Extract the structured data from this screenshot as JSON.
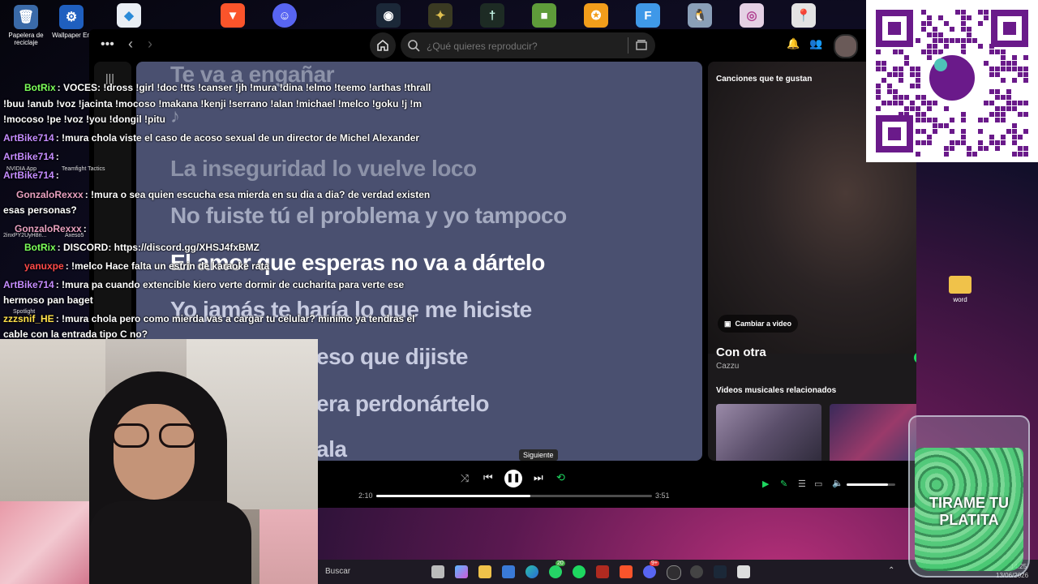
{
  "desktop": {
    "icons_left": [
      {
        "label": "Papelera de reciclaje",
        "icon": "recycle-bin-icon"
      },
      {
        "label": "Wallpaper En",
        "icon": "wallpaper-engine-icon"
      }
    ],
    "top_icons": [
      "kleopatra-icon",
      "brave-icon",
      "discord-icon",
      "steam-icon",
      "game-icon",
      "game2-icon",
      "minecraft-icon",
      "cs-icon",
      "f-icon",
      "penguin-icon",
      "circle-icon",
      "maps-icon"
    ],
    "right_icon": {
      "label": "word",
      "icon": "folder-icon"
    },
    "overlay_labels": {
      "nvidia": "NVIDIA App",
      "teamfight": "Teamfight Tactics",
      "zip": "2inxPY2UyH8ri...",
      "axeso": "Axeso5",
      "spotlight": "Spotlight"
    }
  },
  "spotify": {
    "search_placeholder": "¿Qué quieres reproducir?",
    "lyrics": [
      "Te va a engañar",
      "♪",
      "La inseguridad lo vuelve loco",
      "No fuiste tú el problema y yo tampoco",
      "El amor que esperas no va a dártelo",
      "Yo jamás te haría lo que me hiciste",
      "eso que dijiste",
      "era perdonártelo",
      "ala"
    ],
    "now_playing": {
      "section_title": "Canciones que te gustan",
      "switch_video": "Cambiar a video",
      "song": "Con otra",
      "artist": "Cazzu",
      "related_title": "Videos musicales relacionados"
    },
    "player": {
      "tooltip": "Siguiente",
      "elapsed": "2:10",
      "duration": "3:51",
      "progress": 0.56,
      "volume": 0.85
    }
  },
  "chat": [
    {
      "user": "BotRix",
      "color": "#7cff5a",
      "text": ": VOCES: !dross !girl !doc !tts !canser !jh !mura !dina !elmo !teemo !arthas !thrall"
    },
    {
      "user": "",
      "color": "#ffffff",
      "text": "!buu !anub !voz !jacinta !mocoso !makana !kenji !serrano !alan !michael !melco !goku !j !m"
    },
    {
      "user": "",
      "color": "#ffffff",
      "text": "!mocoso !pe !voz !you !dongil !pitu"
    },
    {
      "user": "ArtBike714",
      "color": "#c58cff",
      "text": ": !mura chola viste el caso de acoso sexual de un director de Michel Alexander"
    },
    {
      "user": "ArtBike714",
      "color": "#c58cff",
      "text": ":"
    },
    {
      "user": "ArtBike714",
      "color": "#c58cff",
      "text": ":"
    },
    {
      "user": "GonzaloRexxx",
      "color": "#e8a0c0",
      "text": ": !mura o sea quien escucha esa mierda en su dia a dia? de verdad existen"
    },
    {
      "user": "",
      "color": "#ffffff",
      "text": "esas personas?"
    },
    {
      "user": "GonzaloRexxx",
      "color": "#e8a0c0",
      "text": ":"
    },
    {
      "user": "BotRix",
      "color": "#7cff5a",
      "text": ": DISCORD: https://discord.gg/XHSJ4fxBMZ"
    },
    {
      "user": "yanuxpe",
      "color": "#ff4a4a",
      "text": ": !melco Hace falta un estrin de karaoke rata"
    },
    {
      "user": "ArtBike714",
      "color": "#c58cff",
      "text": ": !mura pa cuando extencible kiero verte dormir de cucharita para verte ese"
    },
    {
      "user": "",
      "color": "#ffffff",
      "text": "hermoso pan baget"
    },
    {
      "user": "zzzsnif_HE",
      "color": "#ffe14a",
      "text": ": !mura chola pero como mierda vas a cargar tu celular? minimo ya tendras el"
    },
    {
      "user": "",
      "color": "#ffffff",
      "text": "cable con la entrada tipo C no?"
    }
  ],
  "taskbar": {
    "search_placeholder": "Buscar",
    "badge_whatsapp": "20",
    "badge_discord": "9+",
    "time": "14:25",
    "date": "13/06/2026"
  },
  "jar_text": "TIRAME TU PLATITA"
}
